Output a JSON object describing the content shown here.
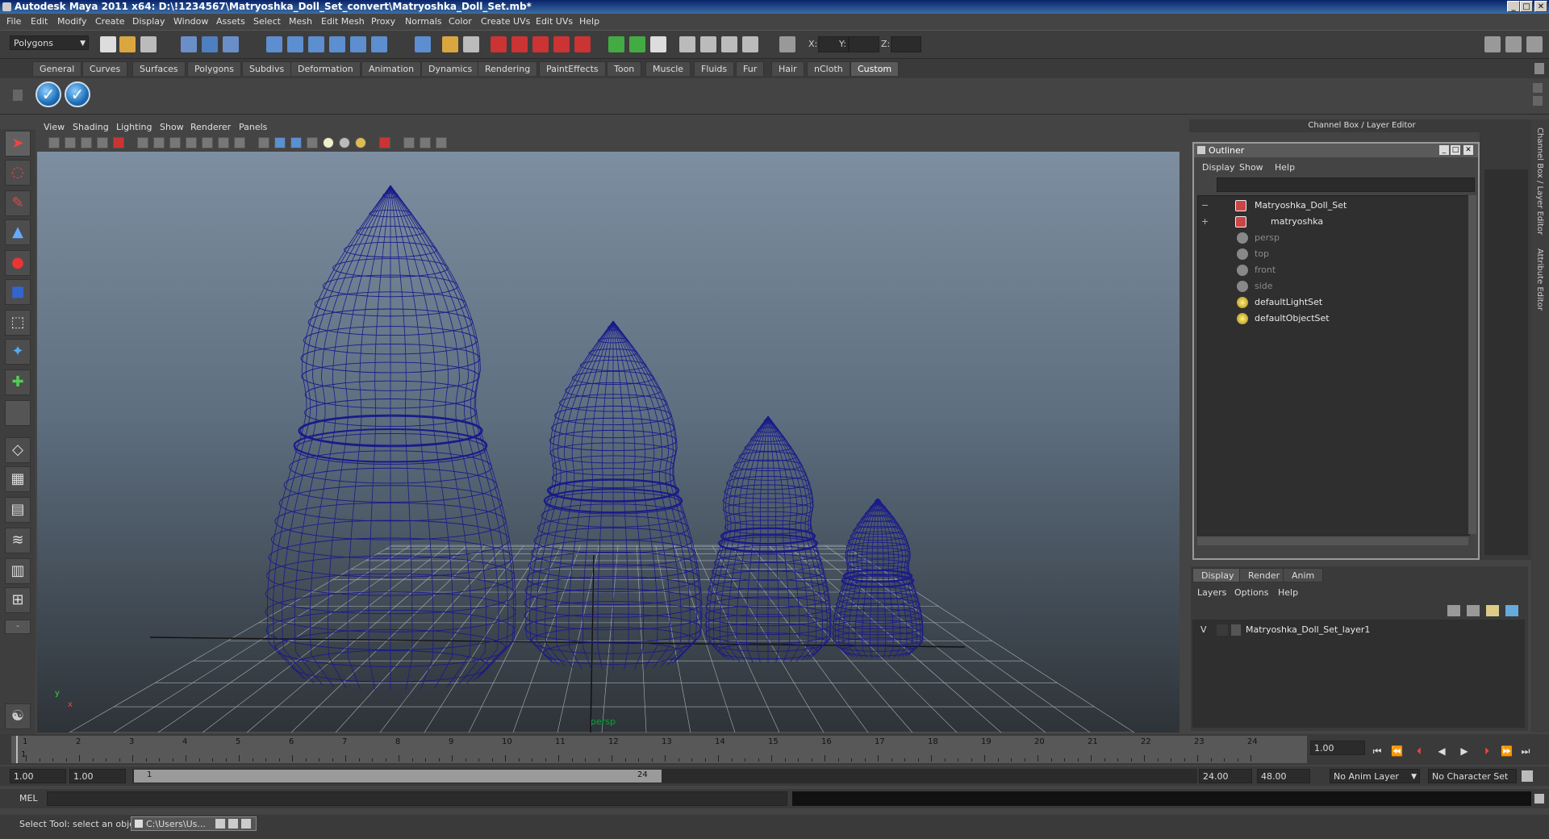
{
  "window": {
    "title": "Autodesk Maya 2011 x64: D:\\!1234567\\Matryoshka_Doll_Set_convert\\Matryoshka_Doll_Set.mb*"
  },
  "menubar": [
    "File",
    "Edit",
    "Modify",
    "Create",
    "Display",
    "Window",
    "Assets",
    "Select",
    "Mesh",
    "Edit Mesh",
    "Proxy",
    "Normals",
    "Color",
    "Create UVs",
    "Edit UVs",
    "Help"
  ],
  "statusline": {
    "mode": "Polygons",
    "x_label": "X:",
    "y_label": "Y:",
    "z_label": "Z:"
  },
  "shelf": {
    "tabs": [
      "General",
      "Curves",
      "Surfaces",
      "Polygons",
      "Subdivs",
      "Deformation",
      "Animation",
      "Dynamics",
      "Rendering",
      "PaintEffects",
      "Toon",
      "Muscle",
      "Fluids",
      "Fur",
      "Hair",
      "nCloth",
      "Custom"
    ],
    "active_tab": "Custom"
  },
  "viewport": {
    "menus": [
      "View",
      "Shading",
      "Lighting",
      "Show",
      "Renderer",
      "Panels"
    ],
    "camera_label": "persp",
    "axis_y": "y",
    "axis_x": "x",
    "wire_color": "#1a1a8a"
  },
  "channelbox": {
    "header": "Channel Box / Layer Editor",
    "side_tab_1": "Channel Box / Layer Editor",
    "side_tab_2": "Attribute Editor"
  },
  "outliner": {
    "title": "Outliner",
    "menus": [
      "Display",
      "Show",
      "Help"
    ],
    "items": [
      {
        "label": "Matryoshka_Doll_Set",
        "expander": "−",
        "dim": false
      },
      {
        "label": "matryoshka",
        "expander": "+",
        "dim": false
      },
      {
        "label": "persp",
        "expander": "",
        "dim": true
      },
      {
        "label": "top",
        "expander": "",
        "dim": true
      },
      {
        "label": "front",
        "expander": "",
        "dim": true
      },
      {
        "label": "side",
        "expander": "",
        "dim": true
      },
      {
        "label": "defaultLightSet",
        "expander": "",
        "dim": false
      },
      {
        "label": "defaultObjectSet",
        "expander": "",
        "dim": false
      }
    ]
  },
  "layer_editor": {
    "tabs": [
      "Display",
      "Render",
      "Anim"
    ],
    "menus": [
      "Layers",
      "Options",
      "Help"
    ],
    "layer_visible": "V",
    "layer_name": "Matryoshka_Doll_Set_layer1"
  },
  "timeline": {
    "ticks": [
      "1",
      "2",
      "3",
      "4",
      "5",
      "6",
      "7",
      "8",
      "9",
      "10",
      "11",
      "12",
      "13",
      "14",
      "15",
      "16",
      "17",
      "18",
      "19",
      "20",
      "21",
      "22",
      "23",
      "24"
    ],
    "current_frame_marker": "1",
    "current_time": "1.00"
  },
  "range": {
    "start": "1.00",
    "playback_start": "1.00",
    "slider_start": "1",
    "slider_end": "24",
    "playback_end": "24.00",
    "end": "48.00",
    "anim_layer": "No Anim Layer",
    "char_set": "No Character Set"
  },
  "cmdline": {
    "label": "MEL"
  },
  "helpline": {
    "text": "Select Tool: select an object",
    "taskbar_item": "C:\\Users\\Us..."
  }
}
